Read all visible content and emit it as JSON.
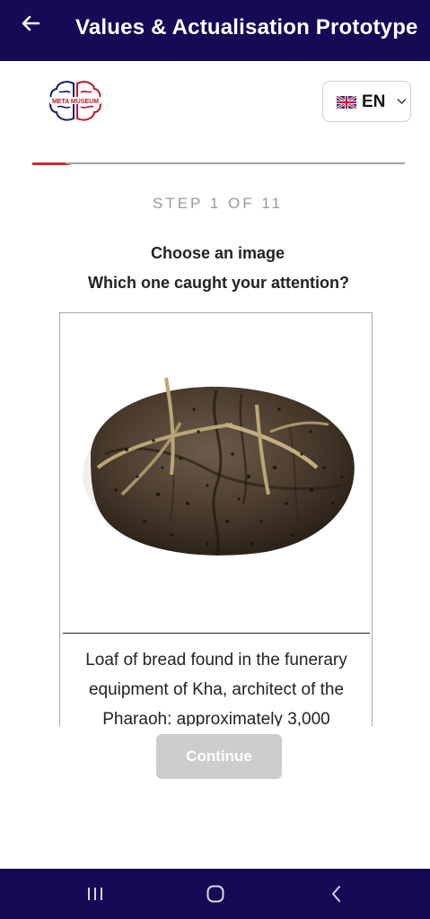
{
  "app_bar": {
    "title": "Values & Actualisation Prototype",
    "back_icon": "arrow-left-icon"
  },
  "logo": {
    "text": "META MUSEUM",
    "icon": "brain-logo-icon"
  },
  "language": {
    "selected": "EN",
    "flag_icon": "uk-flag-icon",
    "chevron_icon": "chevron-down-icon"
  },
  "progress": {
    "current_step": 1,
    "total_steps": 11,
    "label": "STEP 1 OF 11",
    "active_color": "#d22a2a",
    "inactive_color": "#a3a3a3"
  },
  "question": {
    "title": "Choose an image",
    "subtitle": "Which one caught your attention?"
  },
  "card": {
    "image_icon": "bread-loaf-image",
    "caption": "Loaf of bread found in the funerary equipment of Kha, architect of the Pharaoh: approximately 3,000"
  },
  "actions": {
    "continue_label": "Continue"
  },
  "system_nav": {
    "recents_icon": "recents-icon",
    "home_icon": "home-icon",
    "back_icon": "back-chevron-icon"
  },
  "colors": {
    "app_bar": "#140a55",
    "nav_bar": "#140a55",
    "button_disabled": "#cdcdcd",
    "logo_red": "#c0162c",
    "logo_navy": "#1b1a6b"
  }
}
